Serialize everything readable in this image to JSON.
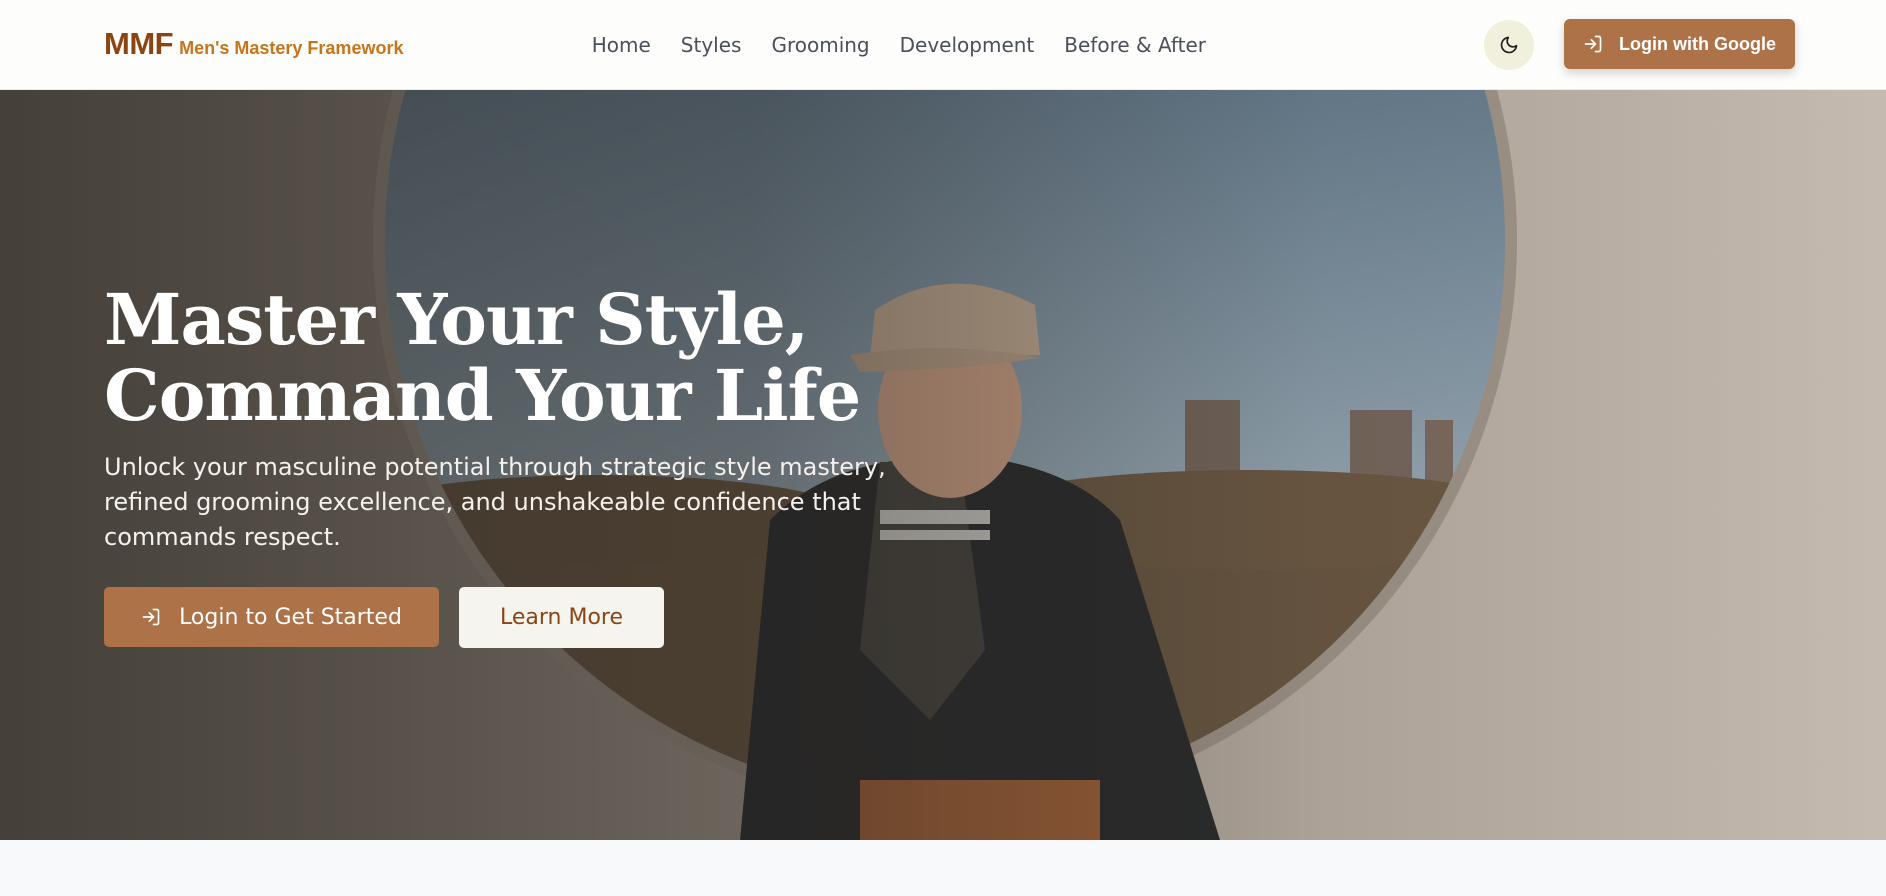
{
  "header": {
    "brand_mark": "MMF",
    "brand_name": "Men's Mastery Framework",
    "nav": [
      "Home",
      "Styles",
      "Grooming",
      "Development",
      "Before & After"
    ],
    "theme_icon": "moon-icon",
    "login_label": "Login with Google",
    "login_icon": "login-arrow-icon"
  },
  "hero": {
    "title_line1": "Master Your Style,",
    "title_line2": "Command Your Life",
    "subtitle": "Unlock your masculine potential through strategic style mastery, refined grooming excellence, and unshakeable confidence that commands respect.",
    "cta_primary": "Login to Get Started",
    "cta_primary_icon": "login-arrow-icon",
    "cta_secondary": "Learn More"
  },
  "colors": {
    "brand": "#8b4513",
    "brand_accent": "#c8741b",
    "button": "#ad7248",
    "nav_text": "#4a4f5a"
  }
}
